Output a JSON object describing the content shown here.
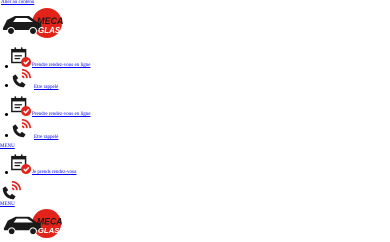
{
  "skip_link": "Aller au contenu",
  "logo": {
    "line1": "MECA",
    "line2": "GLASS",
    "accent": "#e2231a",
    "dark": "#1a1a1a"
  },
  "header_items": [
    {
      "icon": "calendar-check-icon",
      "label": "Prendre rendez-vous en ligne"
    },
    {
      "icon": "phone-ringing-icon",
      "label": "Etre rappelé"
    },
    {
      "icon": "calendar-check-icon",
      "label": "Prendre rendez-vous en ligne"
    },
    {
      "icon": "phone-ringing-icon",
      "label": "Etre rappelé"
    }
  ],
  "menu_label_1": "MENU",
  "mobile_item": {
    "icon": "calendar-check-icon",
    "label": "Je prends rendez-vous"
  },
  "menu_label_2": "MENU"
}
